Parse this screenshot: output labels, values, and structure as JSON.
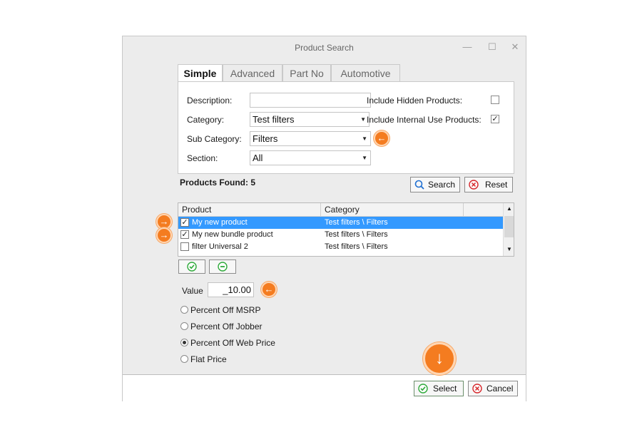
{
  "window": {
    "title": "Product Search",
    "minimize_icon": "—",
    "maximize_icon": "☐",
    "close_icon": "✕"
  },
  "tabs": [
    {
      "label": "Simple"
    },
    {
      "label": "Advanced"
    },
    {
      "label": "Part No"
    },
    {
      "label": "Automotive"
    }
  ],
  "form": {
    "description_label": "Description:",
    "description_value": "",
    "category_label": "Category:",
    "category_value": "Test filters",
    "subcategory_label": "Sub Category:",
    "subcategory_value": "Filters",
    "section_label": "Section:",
    "section_value": "All",
    "include_hidden_label": "Include Hidden Products:",
    "include_hidden_checked": false,
    "include_internal_label": "Include Internal Use Products:",
    "include_internal_checked": true
  },
  "results": {
    "found_label": "Products Found: 5",
    "search_label": "Search",
    "reset_label": "Reset",
    "columns": [
      "Product",
      "Category"
    ],
    "rows": [
      {
        "product": "My new product",
        "category": "Test filters \\ Filters",
        "checked": true,
        "selected": true
      },
      {
        "product": "My new bundle product",
        "category": "Test filters \\ Filters",
        "checked": true,
        "selected": false
      },
      {
        "product": "filter Universal 2",
        "category": "Test filters \\ Filters",
        "checked": false,
        "selected": false
      }
    ]
  },
  "value": {
    "label": "Value",
    "amount": "_10.00"
  },
  "pricing_options": [
    {
      "label": "Percent Off MSRP",
      "selected": false
    },
    {
      "label": "Percent Off Jobber",
      "selected": false
    },
    {
      "label": "Percent Off Web Price",
      "selected": true
    },
    {
      "label": "Flat Price",
      "selected": false
    }
  ],
  "footer": {
    "select_label": "Select",
    "cancel_label": "Cancel"
  },
  "colors": {
    "accent_orange": "#f47c20",
    "selection_blue": "#3399ff",
    "check_green": "#2eaa3a",
    "cancel_red": "#d6262b"
  }
}
